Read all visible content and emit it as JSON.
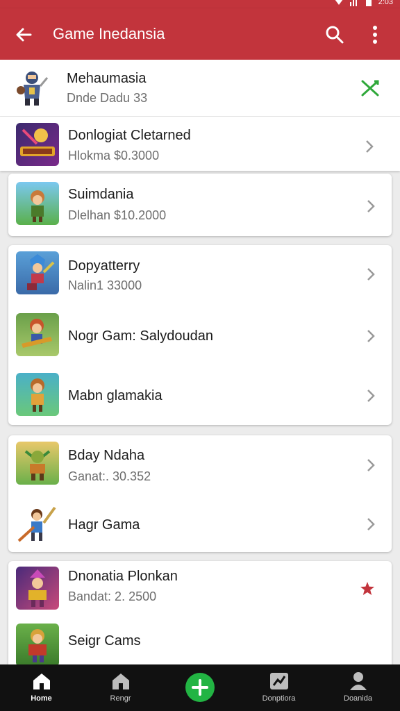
{
  "status_bar": {
    "time": "2:03"
  },
  "app_bar": {
    "title": "Game Inedansia"
  },
  "pinned": {
    "name": "Mehaumasia",
    "subtitle": "Dnde Dadu 33"
  },
  "featured": {
    "name": "Donlogiat Cletarned",
    "subtitle": "Hlokma $0.3000"
  },
  "groups": [
    {
      "items": [
        {
          "name": "Suimdania",
          "subtitle": "Dlelhan $10.2000"
        }
      ]
    },
    {
      "items": [
        {
          "name": "Dopyatterry",
          "subtitle": "Nalin1 33000"
        },
        {
          "name": "Nogr Gam: Salydoudan",
          "subtitle": ""
        },
        {
          "name": "Mabn glamakia",
          "subtitle": ""
        }
      ]
    },
    {
      "items": [
        {
          "name": "Bday Ndaha",
          "subtitle": "Ganat:. 30.352"
        },
        {
          "name": "Hagr Gama",
          "subtitle": ""
        }
      ]
    },
    {
      "items": [
        {
          "name": "Dnonatia Plonkan",
          "subtitle": "Bandat: 2. 2500"
        },
        {
          "name": "Seigr Cams",
          "subtitle": ""
        }
      ]
    }
  ],
  "bottom_nav": [
    {
      "label": "Home",
      "icon": "home-icon",
      "active": true
    },
    {
      "label": "Rengr",
      "icon": "house-icon",
      "active": false
    },
    {
      "label": "Donptiora",
      "icon": "chart-icon",
      "active": false
    },
    {
      "label": "Doanida",
      "icon": "person-icon",
      "active": false
    }
  ],
  "colors": {
    "primary": "#c2343c",
    "accent": "#22b443",
    "favorite": "#c2343c",
    "status_green": "#2fa83a"
  }
}
